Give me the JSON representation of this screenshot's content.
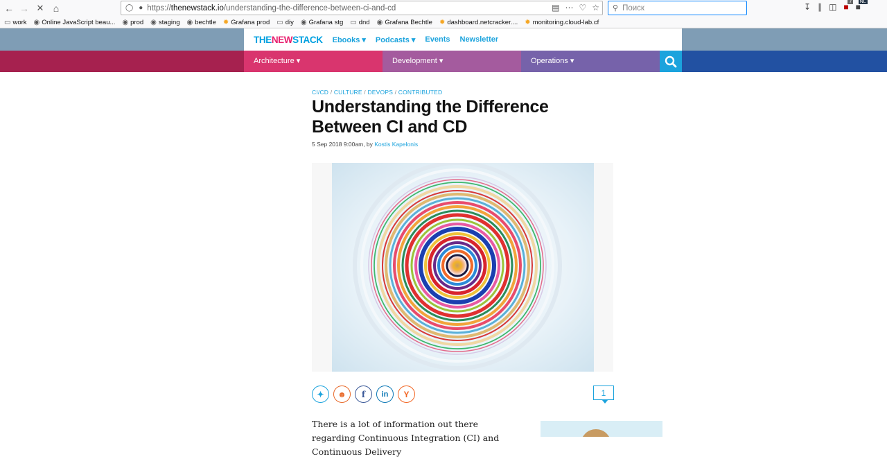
{
  "browser": {
    "url_scheme": "https://",
    "url_host": "thenewstack.io",
    "url_path": "/understanding-the-difference-between-ci-and-cd",
    "search_placeholder": "Поиск",
    "badge_count": "7",
    "badge_lang": "NL"
  },
  "bookmarks": [
    {
      "label": "work",
      "icon": "folder-icon"
    },
    {
      "label": "Online JavaScript beau...",
      "icon": "globe-icon"
    },
    {
      "label": "prod",
      "icon": "globe-icon"
    },
    {
      "label": "staging",
      "icon": "globe-icon"
    },
    {
      "label": "bechtle",
      "icon": "globe-icon"
    },
    {
      "label": "Grafana prod",
      "icon": "grafana-icon"
    },
    {
      "label": "diy",
      "icon": "folder-icon"
    },
    {
      "label": "Grafana stg",
      "icon": "globe-icon"
    },
    {
      "label": "dnd",
      "icon": "folder-icon"
    },
    {
      "label": "Grafana Bechtle",
      "icon": "globe-icon"
    },
    {
      "label": "dashboard.netcracker....",
      "icon": "grafana-icon"
    },
    {
      "label": "monitoring.cloud-lab.cf",
      "icon": "grafana-icon"
    }
  ],
  "site": {
    "logo_the": "THE",
    "logo_new": "NEW",
    "logo_stack": "STACK",
    "topnav": [
      "Ebooks ▾",
      "Podcasts ▾",
      "Events",
      "Newsletter"
    ],
    "categories": [
      "Architecture ▾",
      "Development ▾",
      "Operations ▾"
    ]
  },
  "article": {
    "breadcrumb": [
      "CI/CD",
      "CULTURE",
      "DEVOPS",
      "CONTRIBUTED"
    ],
    "title": "Understanding the Difference Between CI and CD",
    "date": "5 Sep 2018 9:00am, by ",
    "author": "Kostis Kapelonis",
    "comment_count": "1",
    "body_start": "There is a lot of information out there regarding Continuous Integration (CI) and Continuous Delivery"
  },
  "colors": {
    "brand_blue": "#1ba3dd",
    "brand_pink": "#e8206f",
    "cat_architecture": "#d9356e",
    "cat_development": "#a45b9e",
    "cat_operations": "#7662aa"
  }
}
